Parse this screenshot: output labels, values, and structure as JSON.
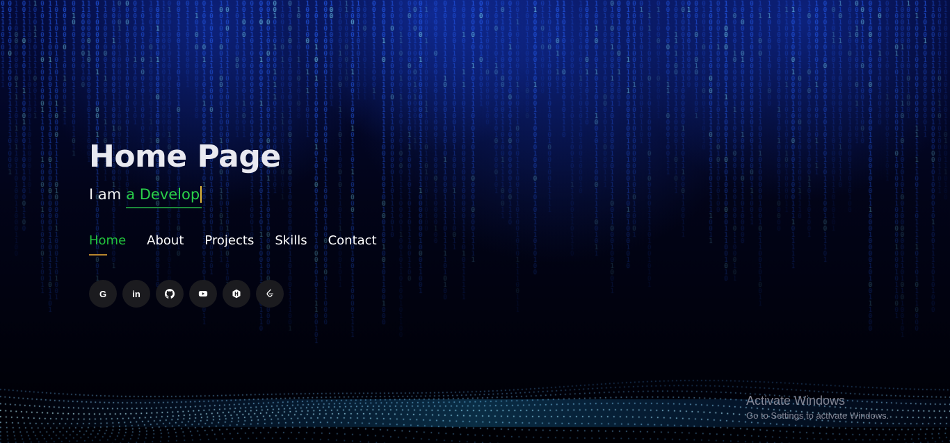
{
  "page": {
    "title": "Home Page",
    "subtitle_static": "I am",
    "typed_text": "a Develop"
  },
  "nav": {
    "items": [
      {
        "label": "Home",
        "active": true
      },
      {
        "label": "About",
        "active": false
      },
      {
        "label": "Projects",
        "active": false
      },
      {
        "label": "Skills",
        "active": false
      },
      {
        "label": "Contact",
        "active": false
      }
    ]
  },
  "socials": [
    {
      "icon": "google-icon",
      "glyph": "G"
    },
    {
      "icon": "linkedin-icon",
      "glyph": "in"
    },
    {
      "icon": "github-icon",
      "glyph": ""
    },
    {
      "icon": "youtube-icon",
      "glyph": ""
    },
    {
      "icon": "hackerrank-icon",
      "glyph": ""
    },
    {
      "icon": "leetcode-icon",
      "glyph": ""
    }
  ],
  "watermark": {
    "title": "Activate Windows",
    "subtitle": "Go to Settings to activate Windows."
  },
  "colors": {
    "background": "#000006",
    "binary_rain": "#1e5bff",
    "accent_green": "#22c43d",
    "underline_gold": "#b8862e",
    "social_bg": "#1b1b1f"
  }
}
